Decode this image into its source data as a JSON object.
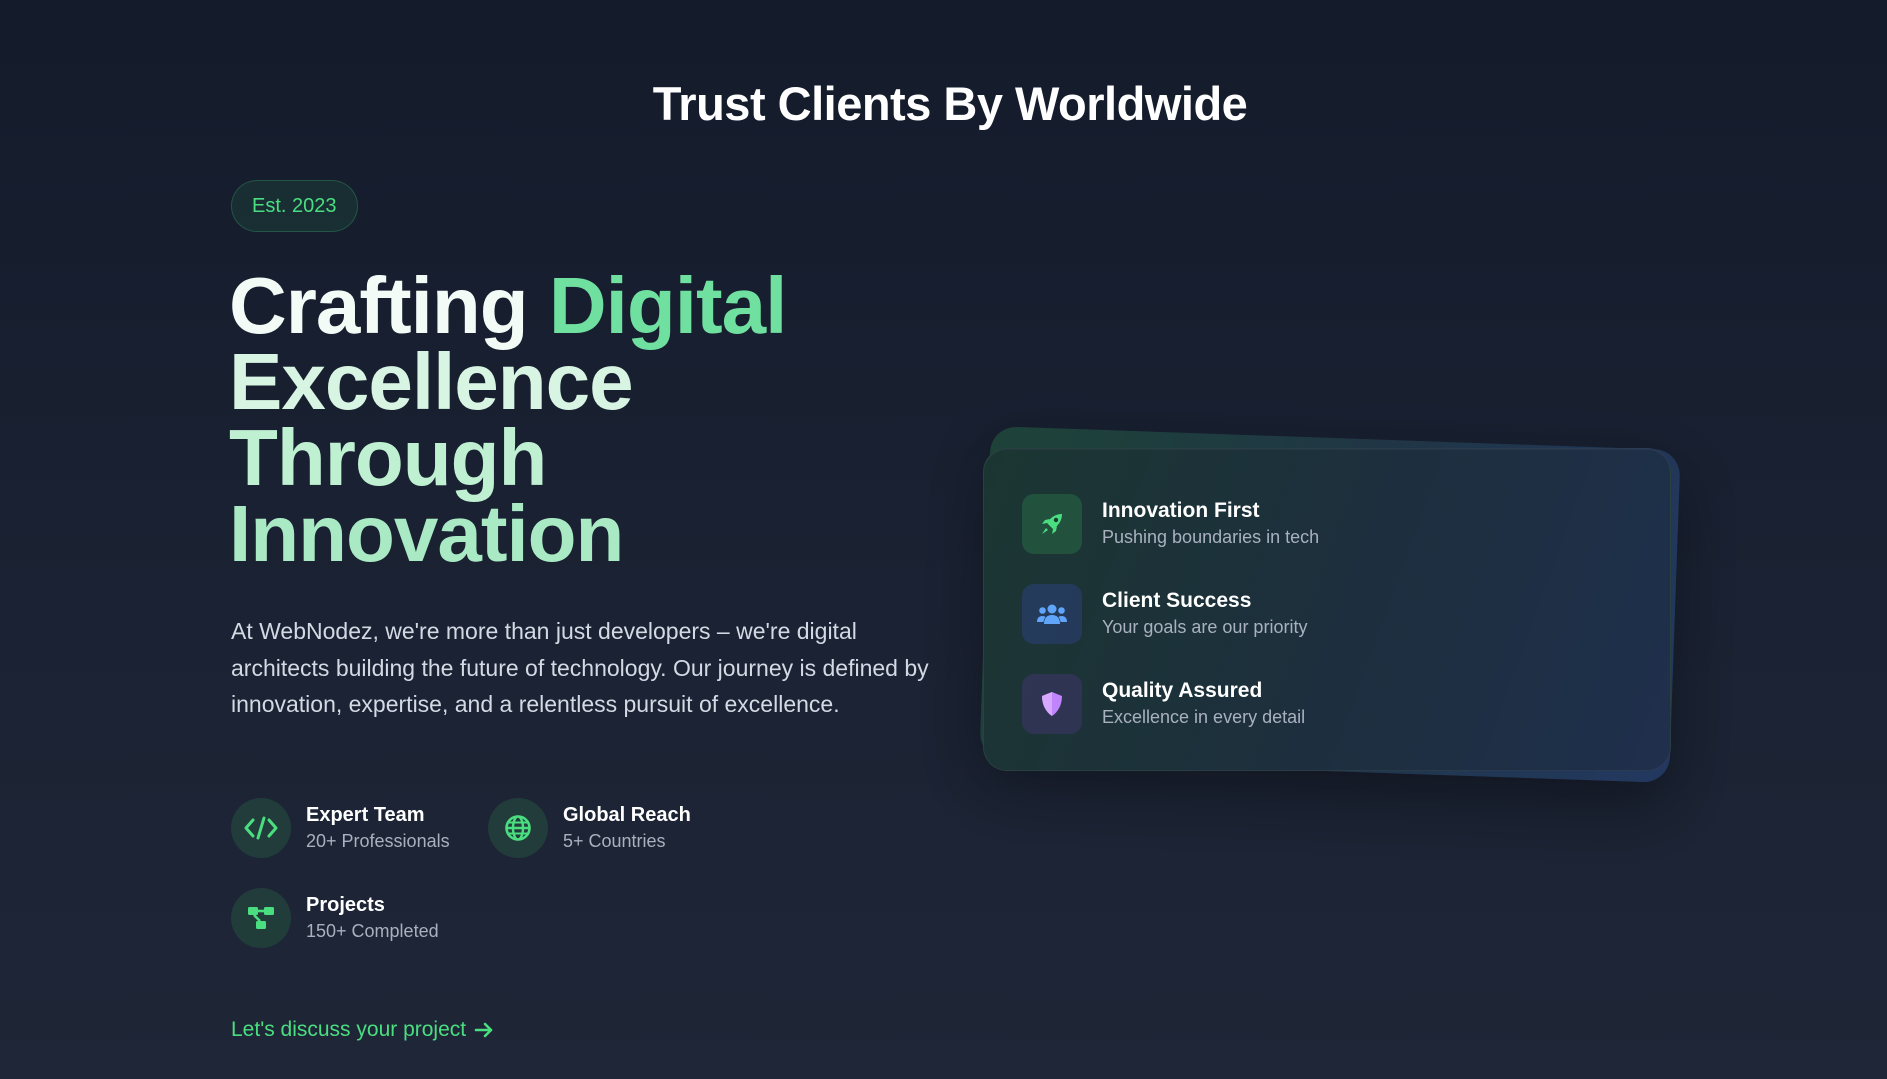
{
  "section": {
    "title": "Trust Clients By Worldwide"
  },
  "hero": {
    "badge": "Est. 2023",
    "headline": {
      "part1": "Crafting ",
      "part2": "Digital",
      "line2": "Excellence",
      "line3": "Through",
      "line4": "Innovation"
    },
    "description": "At WebNodez, we're more than just developers – we're digital architects building the future of technology. Our journey is defined by innovation, expertise, and a relentless pursuit of excellence.",
    "stats": [
      {
        "title": "Expert Team",
        "sub": "20+ Professionals",
        "icon": "code-icon"
      },
      {
        "title": "Global Reach",
        "sub": "5+ Countries",
        "icon": "globe-icon"
      },
      {
        "title": "Projects",
        "sub": "150+ Completed",
        "icon": "project-diagram-icon"
      }
    ],
    "cta": {
      "label": "Let's discuss your project",
      "icon": "arrow-right-icon"
    }
  },
  "features": [
    {
      "title": "Innovation First",
      "sub": "Pushing boundaries in tech",
      "icon": "rocket-icon",
      "color": "#4ade80"
    },
    {
      "title": "Client Success",
      "sub": "Your goals are our priority",
      "icon": "users-icon",
      "color": "#60a5fa"
    },
    {
      "title": "Quality Assured",
      "sub": "Excellence in every detail",
      "icon": "shield-icon",
      "color": "#c084fc"
    }
  ],
  "colors": {
    "accent": "#4ade80",
    "background": "#141b2b",
    "text_muted": "#a9b1bf"
  }
}
